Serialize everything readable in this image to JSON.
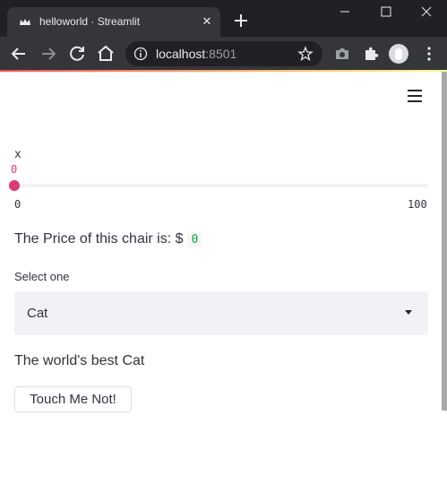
{
  "browser": {
    "tab_title": "helloworld · Streamlit",
    "tab_close_glyph": "✕",
    "url_host": "localhost",
    "url_port": ":8501",
    "icons": [
      "streamlit-crown-icon",
      "new-tab-icon",
      "minimize-icon",
      "maximize-icon",
      "window-close-icon",
      "back-icon",
      "forward-icon",
      "reload-icon",
      "home-icon",
      "info-icon",
      "star-icon",
      "camera-icon",
      "extensions-icon",
      "profile-avatar",
      "kebab-menu-icon"
    ]
  },
  "app": {
    "accent_color": "#e0396f",
    "slider": {
      "label": "x",
      "value": 0,
      "value_text": "0",
      "min_text": "0",
      "max_text": "100",
      "min": 0,
      "max": 100
    },
    "price": {
      "text": "The Price of this chair is: $",
      "value": "0"
    },
    "select": {
      "label": "Select one",
      "selected": "Cat"
    },
    "best_text": "The world's best Cat",
    "button_label": "Touch Me Not!"
  }
}
